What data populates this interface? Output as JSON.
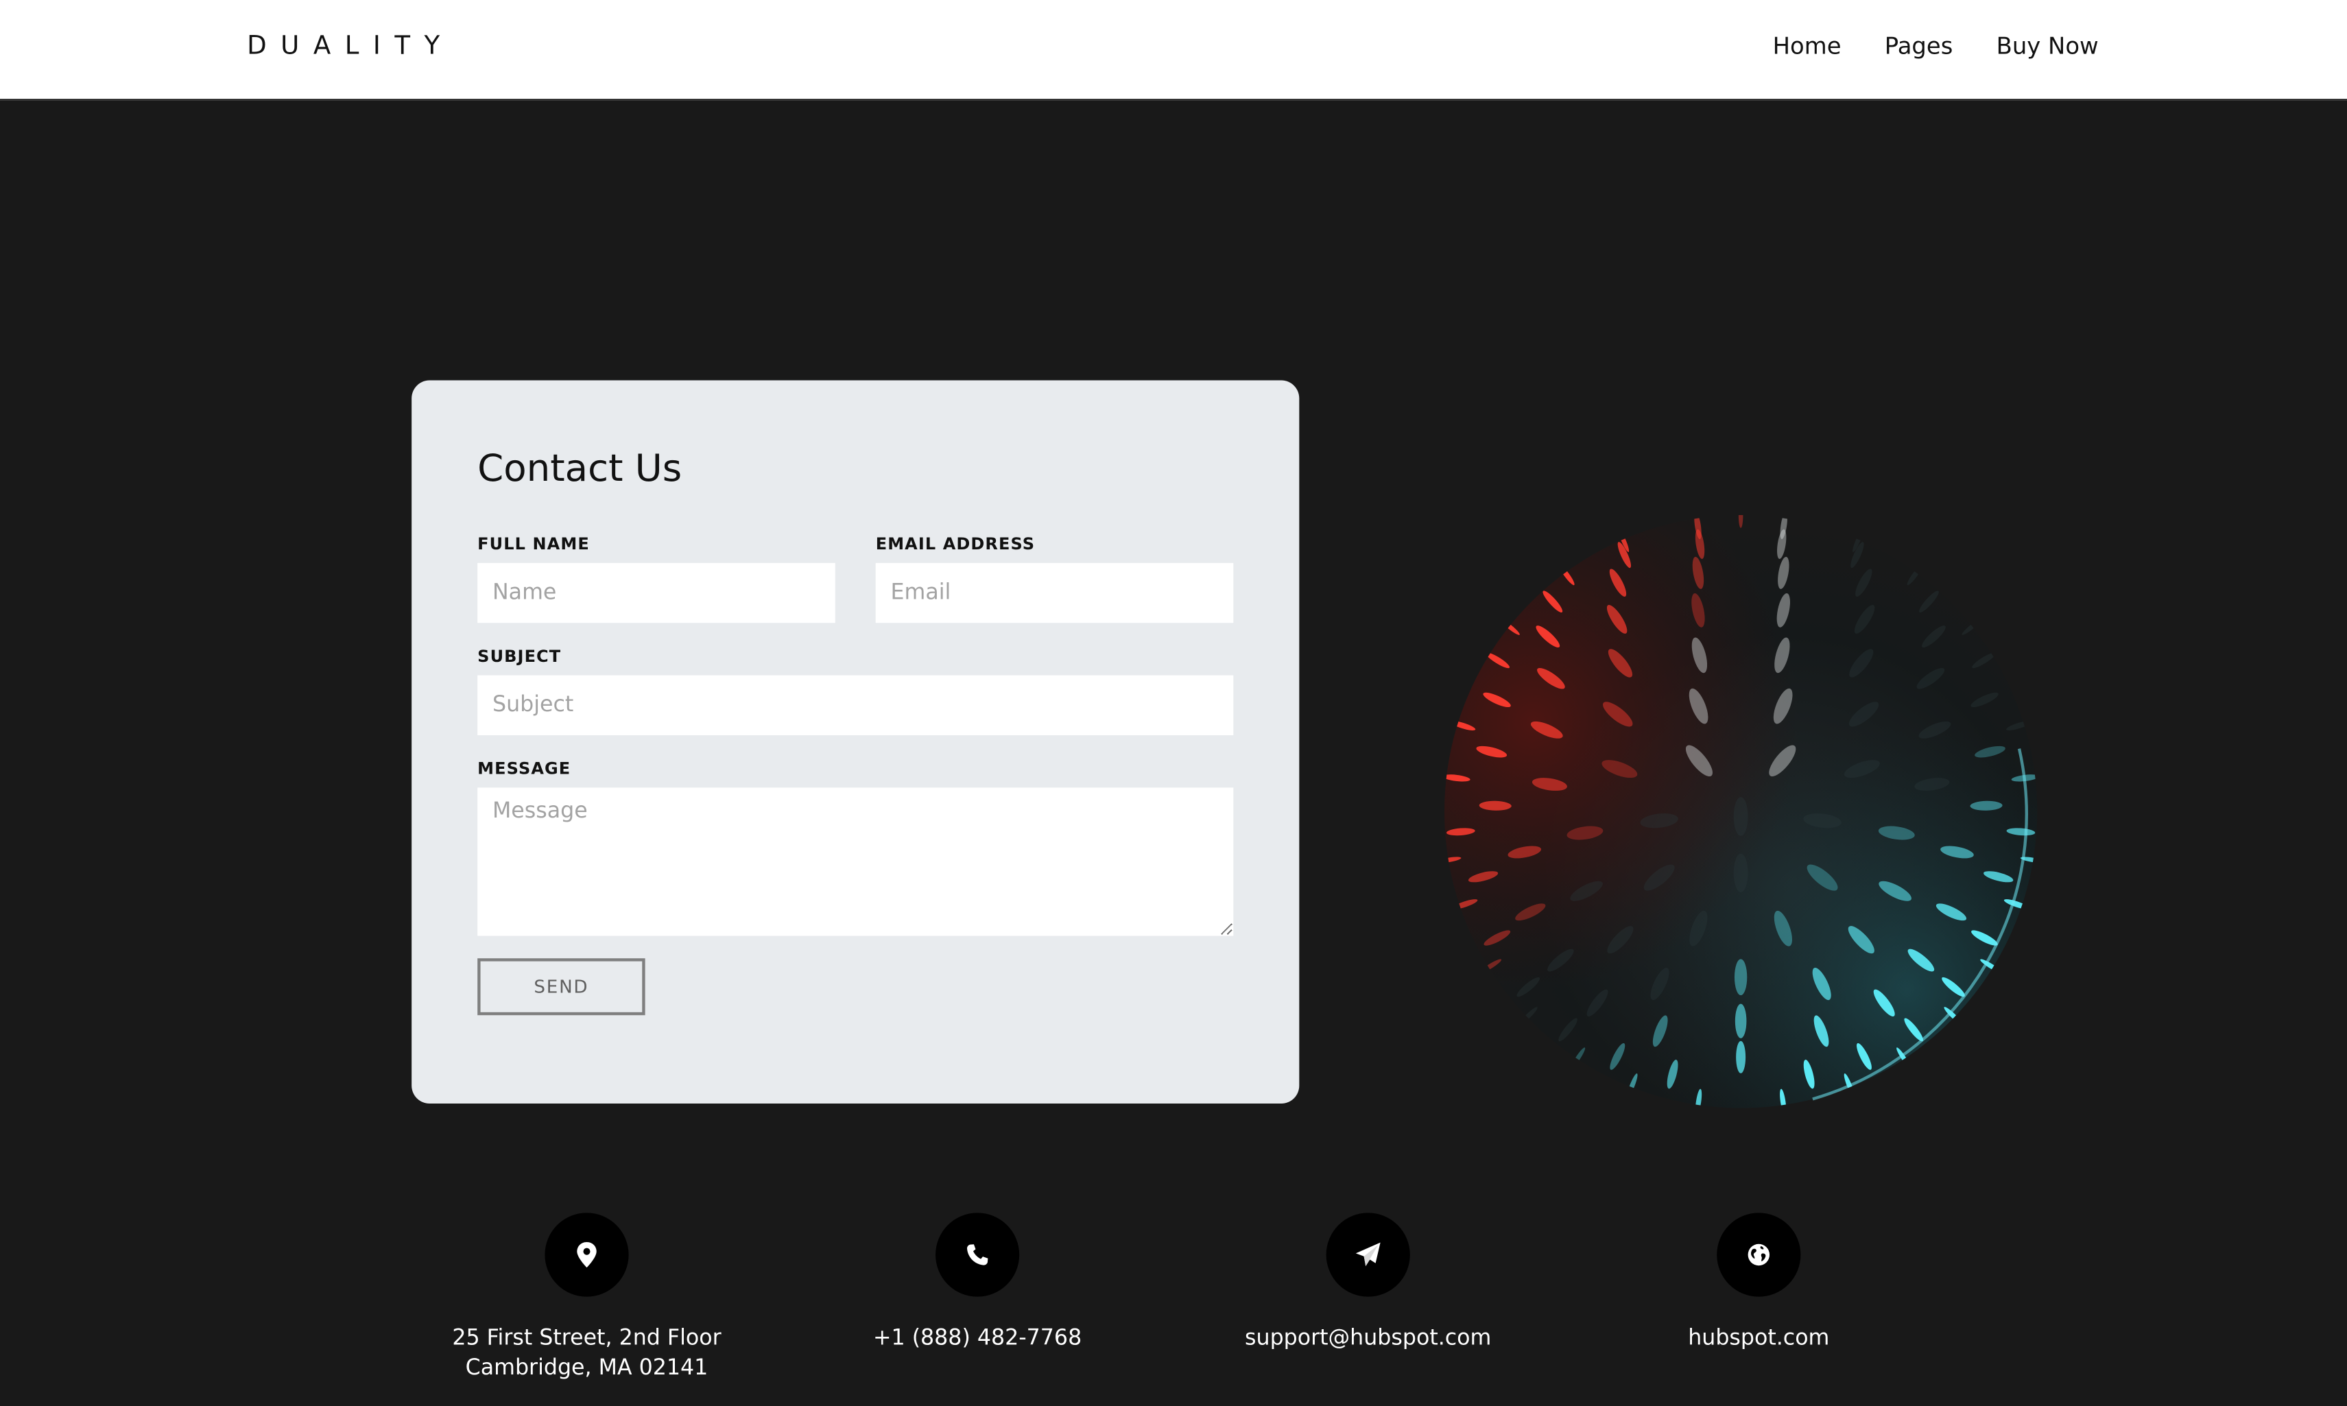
{
  "header": {
    "logo": "DUALITY",
    "nav": [
      "Home",
      "Pages",
      "Buy Now"
    ]
  },
  "contact_form": {
    "title": "Contact Us",
    "full_name_label": "FULL NAME",
    "full_name_placeholder": "Name",
    "email_label": "EMAIL ADDRESS",
    "email_placeholder": "Email",
    "subject_label": "SUBJECT",
    "subject_placeholder": "Subject",
    "message_label": "MESSAGE",
    "message_placeholder": "Message",
    "send_label": "SEND"
  },
  "contact_info": {
    "address_line1": "25 First Street, 2nd Floor",
    "address_line2": "Cambridge, MA 02141",
    "phone": "+1 (888) 482-7768",
    "email": "support@hubspot.com",
    "website": "hubspot.com"
  },
  "icons": {
    "address": "map-pin-icon",
    "phone": "phone-icon",
    "email": "paper-plane-icon",
    "website": "globe-icon"
  },
  "colors": {
    "page_background": "#191919",
    "header_background": "#ffffff",
    "card_background": "#e8ebee",
    "sphere_red_glow": "#ff3b2f",
    "sphere_cyan_glow": "#5ff3ff"
  }
}
